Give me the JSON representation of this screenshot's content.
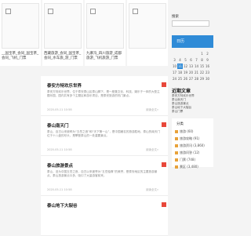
{
  "thumbs": [
    {
      "caption": "__国宝茶_会同_国宝茶_会同_飞机_门票"
    },
    {
      "caption": "西藏旅游_会同_国宝茶_会同_水车旅_游_门票"
    },
    {
      "caption": "九寨沟_四川旅游_成都旅游_飞机旅游_门票"
    },
    {
      "caption": ""
    }
  ],
  "posts": [
    {
      "title": "泰安方特欢乐世界",
      "summary": "泰安方特欢乐世界，位于泰安泰山区泰山脚下，是一座集文化、科技、娱乐于一体的大型主题乐园，园内共有多个主题区和游乐项目，是泰安旅游的热门景点。",
      "date": "2020-05-11 10:58",
      "more": "阅读全文»"
    },
    {
      "title": "泰山南天门",
      "summary": "泰山，自古以来被称为“五岳之首”和“天下第一山”，是中国著名的旅游胜地，泰山的南天门位于十八盘的尽头，是攀登泰山的一处重要景点。",
      "date": "2020-05-11 10:58",
      "more": "阅读全文»"
    },
    {
      "title": "泰山旅游景点",
      "summary": "泰山，旧为中国五岳之首，自古以来被誉为“五岳独尊”的美誉，是泰安地区的主要旅游景点，泰山旅游景点众多，吸引了大量游客前来。",
      "date": "2020-05-11 10:58",
      "more": "阅读全文»"
    },
    {
      "title": "泰山地下大裂谷",
      "summary": "",
      "date": "",
      "more": ""
    }
  ],
  "sidebar": {
    "search_label": "搜索",
    "search_placeholder": "",
    "calendar_title": "日历",
    "calendar_days": [
      "",
      "",
      "",
      "",
      "",
      "1",
      "2",
      "3",
      "4",
      "5",
      "6",
      "7",
      "8",
      "9",
      "10",
      "11",
      "12",
      "13",
      "14",
      "15",
      "16",
      "17",
      "18",
      "19",
      "20",
      "21",
      "22",
      "23",
      "24",
      "25",
      "26",
      "27",
      "28",
      "29",
      "30"
    ],
    "calendar_today": "11",
    "recent_title": "近期文章",
    "recent": [
      "泰安方特欢乐世界",
      "泰山南天门",
      "泰山旅游景点",
      "泰山地下大裂谷",
      "泰山门票"
    ],
    "category_title": "分类",
    "categories": [
      "旅游 (60)",
      "旅游攻略 (91)",
      "旅游资讯 (3,860)",
      "旅游问答 (12)",
      "门票 (748)",
      "景区 (3,480)"
    ]
  }
}
